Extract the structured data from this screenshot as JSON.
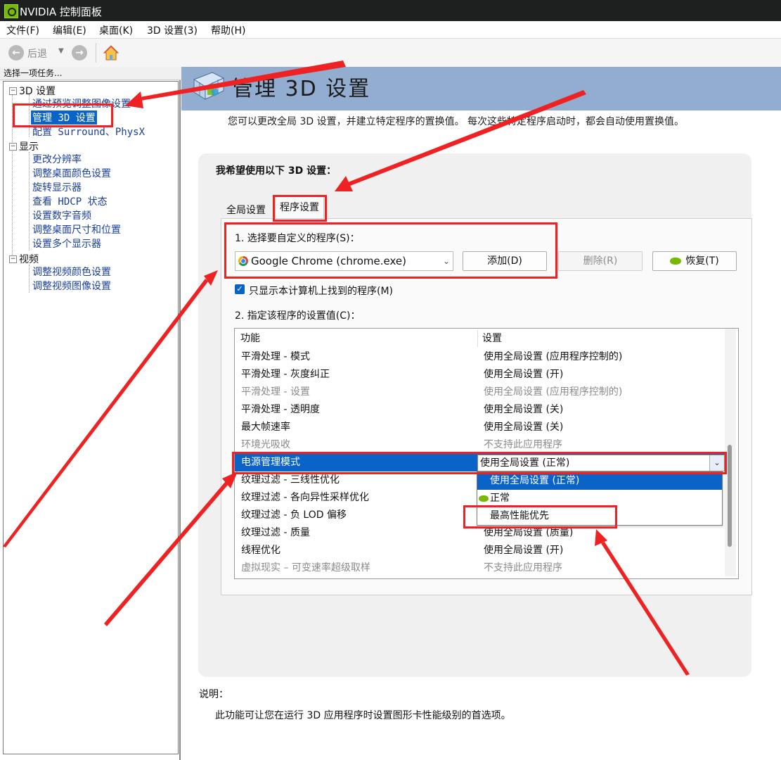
{
  "window": {
    "title": "NVIDIA 控制面板"
  },
  "menu": [
    "文件(F)",
    "编辑(E)",
    "桌面(K)",
    "3D 设置(3)",
    "帮助(H)"
  ],
  "toolbar": {
    "back_label": "后退"
  },
  "left_panel": {
    "header": "选择一项任务...",
    "groups": [
      {
        "label": "3D 设置",
        "items": [
          "通过预览调整图像设置",
          "管理 3D 设置",
          "配置 Surround、PhysX"
        ]
      },
      {
        "label": "显示",
        "items": [
          "更改分辨率",
          "调整桌面颜色设置",
          "旋转显示器",
          "查看 HDCP 状态",
          "设置数字音频",
          "调整桌面尺寸和位置",
          "设置多个显示器"
        ]
      },
      {
        "label": "视频",
        "items": [
          "调整视频颜色设置",
          "调整视频图像设置"
        ]
      }
    ]
  },
  "main": {
    "title": "管理 3D 设置",
    "description": "您可以更改全局 3D 设置，并建立特定程序的置换值。 每次这些特定程序启动时，都会自动使用置换值。",
    "panel_title": "我希望使用以下 3D 设置：",
    "tabs": [
      "全局设置",
      "程序设置"
    ],
    "step1_label": "1. 选择要自定义的程序(S)：",
    "program": "Google Chrome (chrome.exe)",
    "buttons": {
      "add": "添加(D)",
      "delete": "删除(R)",
      "restore": "恢复(T)"
    },
    "checkbox_label": "只显示本计算机上找到的程序(M)",
    "step2_label": "2. 指定该程序的设置值(C)：",
    "table": {
      "headers": [
        "功能",
        "设置"
      ],
      "rows": [
        {
          "feature": "平滑处理 - 模式",
          "setting": "使用全局设置 (应用程序控制的)"
        },
        {
          "feature": "平滑处理 - 灰度纠正",
          "setting": "使用全局设置 (开)"
        },
        {
          "feature": "平滑处理 - 设置",
          "setting": "使用全局设置 (应用程序控制的)"
        },
        {
          "feature": "平滑处理 - 透明度",
          "setting": "使用全局设置 (关)"
        },
        {
          "feature": "最大帧速率",
          "setting": "使用全局设置 (关)"
        },
        {
          "feature": "环境光吸收",
          "setting": "不支持此应用程序"
        },
        {
          "feature": "电源管理模式",
          "setting": "使用全局设置 (正常)"
        },
        {
          "feature": "纹理过滤 - 三线性优化",
          "setting": ""
        },
        {
          "feature": "纹理过滤 - 各向异性采样优化",
          "setting": ""
        },
        {
          "feature": "纹理过滤 - 负 LOD 偏移",
          "setting": ""
        },
        {
          "feature": "纹理过滤 - 质量",
          "setting": "使用全局设置 (质量)"
        },
        {
          "feature": "线程优化",
          "setting": "使用全局设置 (开)"
        },
        {
          "feature": "虚拟现实 – 可变速率超级取样",
          "setting": "不支持此应用程序"
        }
      ]
    },
    "dropdown_options": [
      "使用全局设置 (正常)",
      "正常",
      "最高性能优先"
    ],
    "explain_title": "说明：",
    "explain_text": "此功能可让您在运行 3D 应用程序时设置图形卡性能级别的首选项。"
  },
  "colors": {
    "accent": "#0a64c8",
    "annotation_red": "#ee2222",
    "banner": "#93add0",
    "nvidia_green": "#76b900"
  }
}
